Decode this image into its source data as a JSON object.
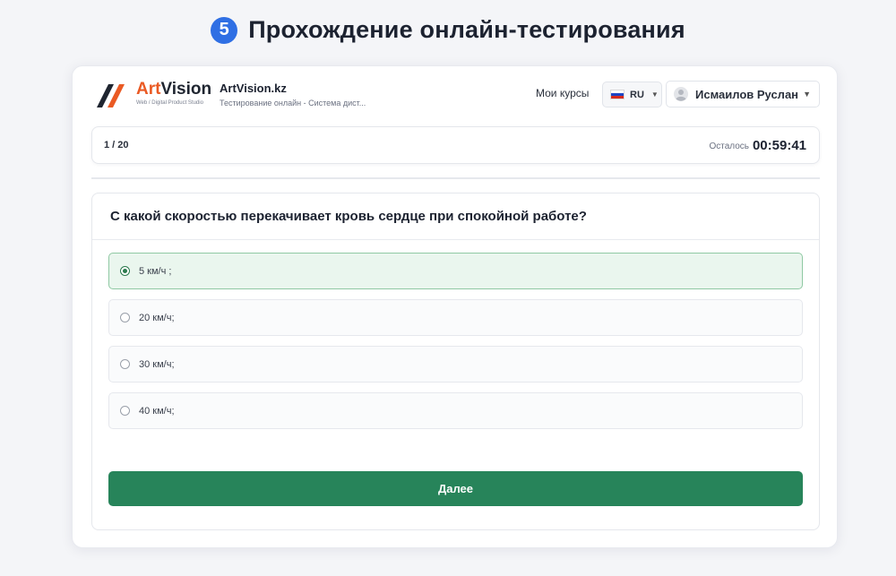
{
  "heading": {
    "step": "5",
    "title": "Прохождение онлайн-тестирования"
  },
  "brand": {
    "name_part1": "Art",
    "name_part2": "Vision",
    "tagline": "Web / Digital Product Studio",
    "accent": "#ea5a24"
  },
  "site": {
    "title": "ArtVision.kz",
    "subtitle": "Тестирование онлайн - Система дист..."
  },
  "header": {
    "courses_label": "Мои курсы",
    "language": {
      "code": "RU",
      "icon": "russia-flag-icon"
    },
    "user": {
      "name": "Исмаилов Руслан",
      "icon": "user-avatar-icon"
    }
  },
  "progress": {
    "counter": "1 / 20",
    "remaining_label": "Осталось",
    "timer": "00:59:41"
  },
  "question": {
    "text": "С какой скоростью перекачивает кровь сердце при спокойной работе?",
    "options": [
      {
        "label": "5 км/ч ;",
        "selected": true
      },
      {
        "label": "20 км/ч;",
        "selected": false
      },
      {
        "label": "30 км/ч;",
        "selected": false
      },
      {
        "label": "40 км/ч;",
        "selected": false
      }
    ]
  },
  "actions": {
    "next_label": "Далее",
    "next_color": "#27845a"
  }
}
